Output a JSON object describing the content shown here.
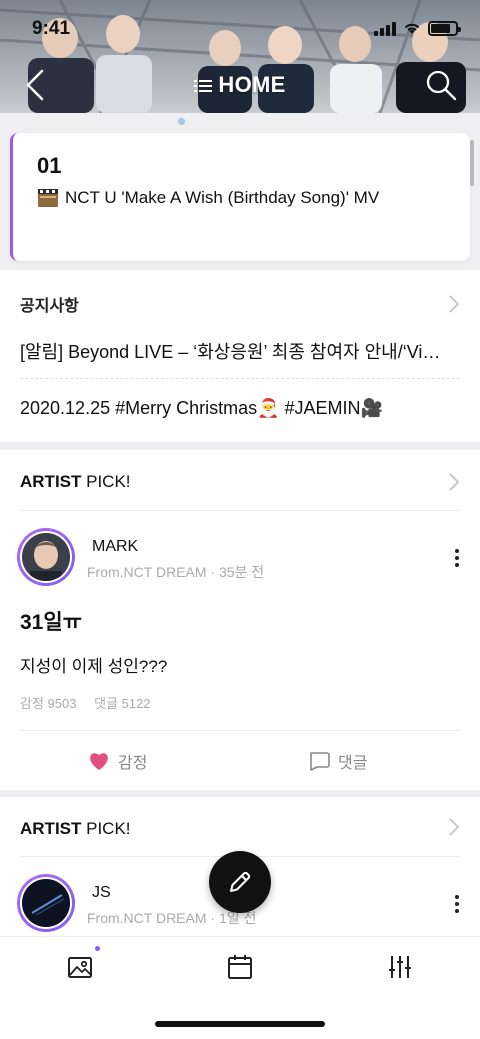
{
  "status_bar": {
    "time": "9:41"
  },
  "header": {
    "title": "HOME"
  },
  "hot_post": {
    "rank": "01",
    "title": "NCT U 'Make A Wish (Birthday Song)' MV"
  },
  "notice": {
    "heading": "공지사항",
    "items": [
      "[알림] Beyond LIVE – ‘화상응원’ 최종 참여자 안내/‘Vi…",
      "2020.12.25 #Merry Christmas🎅 #JAEMIN🎥"
    ]
  },
  "artist_picks": [
    {
      "label_bold": "ARTIST",
      "label_rest": " PICK!",
      "artist": "MARK",
      "meta": "From.NCT DREAM · 35분 전",
      "post_title": "31일ㅠ",
      "post_body": "지성이 이제 성인???",
      "stats": {
        "likes": "감정 9503",
        "comments": "댓글 5122"
      },
      "actions": {
        "like": "감정",
        "comment": "댓글"
      }
    },
    {
      "label_bold": "ARTIST",
      "label_rest": " PICK!",
      "artist": "JS",
      "meta": "From.NCT DREAM · 1일 전"
    }
  ],
  "colors": {
    "accent_purple": "#9b5ce0",
    "like_pink": "#e0517f",
    "highlight": "#e8d8ff"
  },
  "icons": {
    "back": "chevron-left-icon",
    "menu": "menu-icon",
    "search": "search-icon",
    "photo": "photo-icon",
    "calendar": "calendar-icon",
    "settings": "sliders-icon",
    "compose": "pencil-icon"
  }
}
